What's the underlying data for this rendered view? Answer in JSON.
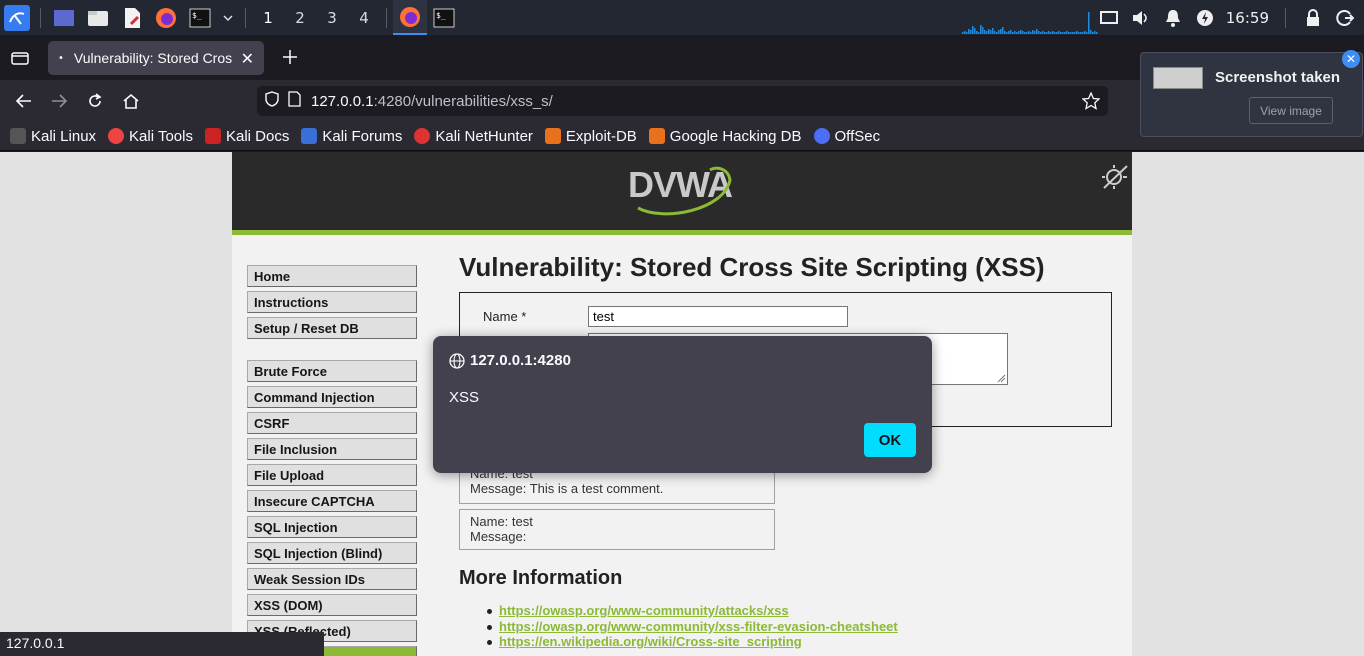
{
  "taskbar": {
    "workspaces": [
      "1",
      "2",
      "3",
      "4"
    ],
    "clock": "16:59",
    "icons": [
      "kali-menu-icon",
      "desktop-icon",
      "files-icon",
      "text-editor-icon",
      "firefox-icon",
      "terminal-icon"
    ]
  },
  "browser": {
    "tab_title": "Vulnerability: Stored Cros",
    "url_host": "127.0.0.1",
    "url_rest": ":4280/vulnerabilities/xss_s/",
    "bookmarks": [
      "Kali Linux",
      "Kali Tools",
      "Kali Docs",
      "Kali Forums",
      "Kali NetHunter",
      "Exploit-DB",
      "Google Hacking DB",
      "OffSec"
    ]
  },
  "dvwa": {
    "logo": "DVWA",
    "menu_top": [
      "Home",
      "Instructions",
      "Setup / Reset DB"
    ],
    "menu_vulns": [
      "Brute Force",
      "Command Injection",
      "CSRF",
      "File Inclusion",
      "File Upload",
      "Insecure CAPTCHA",
      "SQL Injection",
      "SQL Injection (Blind)",
      "Weak Session IDs",
      "XSS (DOM)",
      "XSS (Reflected)"
    ],
    "heading": "Vulnerability: Stored Cross Site Scripting (XSS)",
    "form": {
      "name_label": "Name *",
      "name_value": "test"
    },
    "entries": [
      {
        "name": "Name: test",
        "message": "Message: This is a test comment."
      },
      {
        "name": "Name: test",
        "message": "Message:"
      }
    ],
    "more_info_heading": "More Information",
    "links": [
      "https://owasp.org/www-community/attacks/xss",
      "https://owasp.org/www-community/xss-filter-evasion-cheatsheet",
      "https://en.wikipedia.org/wiki/Cross-site_scripting"
    ]
  },
  "dialog": {
    "origin": "127.0.0.1:4280",
    "message": "XSS",
    "ok_label": "OK"
  },
  "notification": {
    "title": "Screenshot taken",
    "button": "View image"
  },
  "statusbar": {
    "text": "127.0.0.1"
  },
  "colors": {
    "dvwa_green": "#8cb936",
    "ok_button": "#00ddff",
    "taskbar": "#232732"
  }
}
